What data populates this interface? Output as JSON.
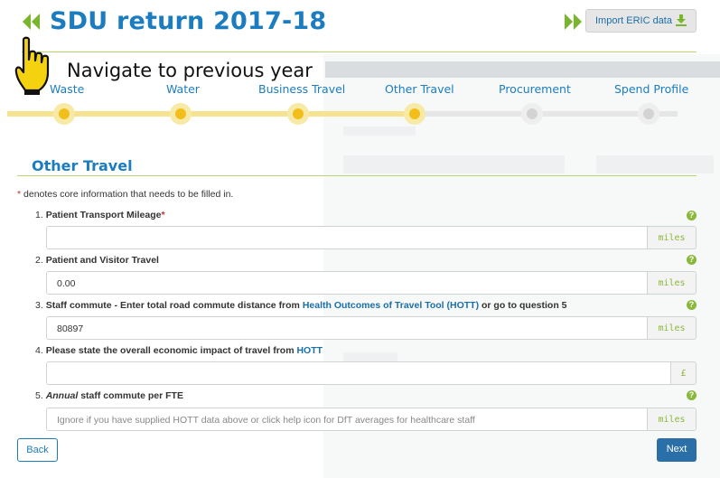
{
  "header": {
    "title": "SDU return 2017-18",
    "back_icon": "double-chevron-left-icon",
    "forward_icon": "double-chevron-right-icon",
    "import_label": "Import ERIC data",
    "import_icon": "download-icon"
  },
  "tooltip": {
    "text": "Navigate to previous year",
    "icon": "pointing-hand-cursor-icon"
  },
  "stepper": {
    "steps": [
      {
        "label": "Waste",
        "state": "done"
      },
      {
        "label": "Water",
        "state": "done"
      },
      {
        "label": "Business Travel",
        "state": "done"
      },
      {
        "label": "Other Travel",
        "state": "current"
      },
      {
        "label": "Procurement",
        "state": "todo"
      },
      {
        "label": "Spend Profile",
        "state": "todo"
      }
    ]
  },
  "section": {
    "title": "Other Travel",
    "core_star": "*",
    "core_note": " denotes core information that needs to be filled in."
  },
  "questions": [
    {
      "num": "1.",
      "label": "Patient Transport Mileage",
      "required": "*",
      "value": "",
      "placeholder": "",
      "unit": "miles"
    },
    {
      "num": "2.",
      "label": "Patient and Visitor Travel",
      "value": "0.00",
      "placeholder": "",
      "unit": "miles"
    },
    {
      "num": "3.",
      "label_pre": "Staff commute - Enter total road commute distance from ",
      "link": "Health Outcomes of Travel Tool (HOTT)",
      "label_post": " or go to question 5",
      "value": "80897",
      "placeholder": "",
      "unit": "miles"
    },
    {
      "num": "4.",
      "label_pre": "Please state the overall economic impact of travel from ",
      "link": "HOTT",
      "value": "",
      "placeholder": "",
      "unit": "£"
    },
    {
      "num": "5.",
      "label_em": "Annual",
      "label_post": " staff commute per FTE",
      "value": "",
      "placeholder": "Ignore if you have supplied HOTT data above or click help icon for DfT averages for healthcare staff",
      "unit": "miles"
    }
  ],
  "help_glyph": "?",
  "help_icon": "help-circle-icon",
  "footer": {
    "back_label": "Back",
    "next_label": "Next"
  },
  "colors": {
    "accent_blue": "#1b7dbf",
    "accent_green": "#8ab83a",
    "progress_yellow": "#f2be1c"
  }
}
